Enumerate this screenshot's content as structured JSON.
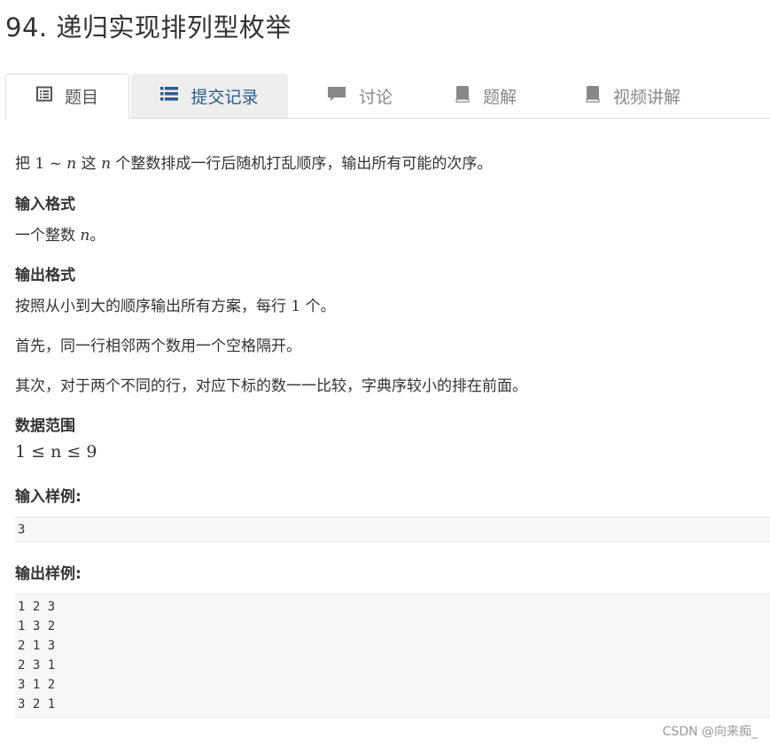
{
  "page_title": "94. 递归实现排列型枚举",
  "tabs": [
    {
      "label": "题目",
      "icon": "list-alt-icon"
    },
    {
      "label": "提交记录",
      "icon": "list-icon"
    },
    {
      "label": "讨论",
      "icon": "comment-icon"
    },
    {
      "label": "题解",
      "icon": "book-icon"
    },
    {
      "label": "视频讲解",
      "icon": "book-icon"
    }
  ],
  "problem": {
    "description_prefix": "把 ",
    "description_math_1": "1",
    "description_tilde": " ~ ",
    "description_math_n": "n",
    "description_mid": " 这 ",
    "description_math_n2": "n",
    "description_suffix": " 个整数排成一行后随机打乱顺序，输出所有可能的次序。",
    "input_format_heading": "输入格式",
    "input_format_text_prefix": "一个整数 ",
    "input_format_math": "n",
    "input_format_text_suffix": "。",
    "output_format_heading": "输出格式",
    "output_line1_prefix": "按照从小到大的顺序输出所有方案，每行 ",
    "output_line1_math": "1",
    "output_line1_suffix": " 个。",
    "output_line2": "首先，同一行相邻两个数用一个空格隔开。",
    "output_line3": "其次，对于两个不同的行，对应下标的数一一比较，字典序较小的排在前面。",
    "range_heading": "数据范围",
    "range_math": "1 ≤ n ≤ 9",
    "sample_input_heading": "输入样例:",
    "sample_input": [
      "3"
    ],
    "sample_output_heading": "输出样例:",
    "sample_output": [
      "1 2 3",
      "1 3 2",
      "2 1 3",
      "2 3 1",
      "3 1 2",
      "3 2 1"
    ]
  },
  "watermark": "CSDN @向来痴_"
}
